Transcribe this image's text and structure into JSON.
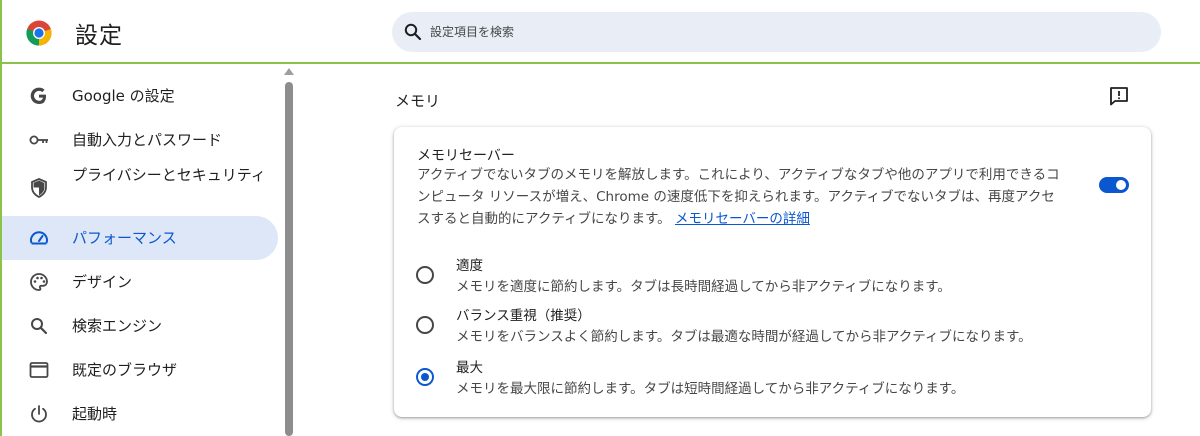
{
  "header": {
    "title": "設定",
    "search_placeholder": "設定項目を検索"
  },
  "sidebar": {
    "items": [
      {
        "label": "Google の設定",
        "icon": "google-icon"
      },
      {
        "label": "自動入力とパスワード",
        "icon": "key-icon"
      },
      {
        "label": "プライバシーとセキュリティ",
        "icon": "shield-icon"
      },
      {
        "label": "パフォーマンス",
        "icon": "speedometer-icon",
        "active": true
      },
      {
        "label": "デザイン",
        "icon": "palette-icon"
      },
      {
        "label": "検索エンジン",
        "icon": "search-icon"
      },
      {
        "label": "既定のブラウザ",
        "icon": "browser-window-icon"
      },
      {
        "label": "起動時",
        "icon": "power-icon"
      }
    ]
  },
  "main": {
    "section_title": "メモリ",
    "card": {
      "title": "メモリセーバー",
      "description": "アクティブでないタブのメモリを解放します。これにより、アクティブなタブや他のアプリで利用できるコンピュータ リソースが増え、Chrome の速度低下を抑えられます。アクティブでないタブは、再度アクセスすると自動的にアクティブになります。",
      "learn_more": "メモリセーバーの詳細",
      "toggle_on": true,
      "options": [
        {
          "label": "適度",
          "description": "メモリを適度に節約します。タブは長時間経過してから非アクティブになります。",
          "selected": false
        },
        {
          "label": "バランス重視（推奨）",
          "description": "メモリをバランスよく節約します。タブは最適な時間が経過してから非アクティブになります。",
          "selected": false
        },
        {
          "label": "最大",
          "description": "メモリを最大限に節約します。タブは短時間経過してから非アクティブになります。",
          "selected": true
        }
      ]
    }
  },
  "colors": {
    "accent": "#0b57d0",
    "active_nav_bg": "#dde7f8",
    "search_bg": "#e9eef6"
  }
}
